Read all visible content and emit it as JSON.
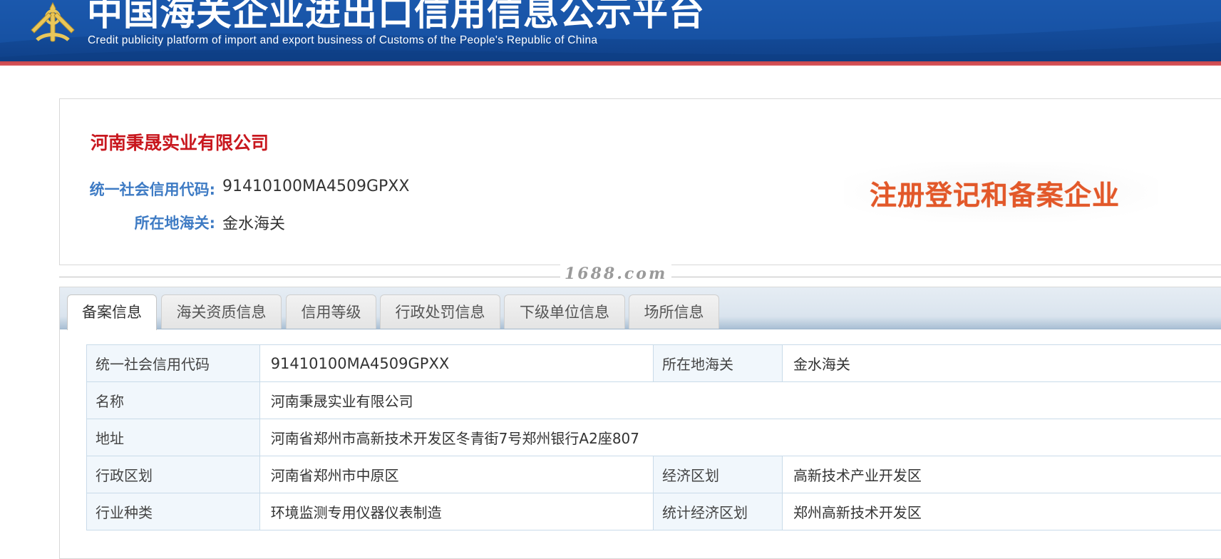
{
  "header": {
    "title_cn": "中国海关企业进出口信用信息公示平台",
    "title_en": "Credit publicity platform of import and export business of Customs of the People's Republic of China",
    "logo_icon": "customs-emblem-icon"
  },
  "company": {
    "name": "河南秉晟实业有限公司",
    "credit_code_label": "统一社会信用代码:",
    "credit_code": "91410100MA4509GPXX",
    "customs_label": "所在地海关:",
    "customs": "金水海关",
    "stamp": "注册登记和备案企业"
  },
  "watermark": "1688.com",
  "tabs": [
    {
      "label": "备案信息",
      "active": true
    },
    {
      "label": "海关资质信息",
      "active": false
    },
    {
      "label": "信用等级",
      "active": false
    },
    {
      "label": "行政处罚信息",
      "active": false
    },
    {
      "label": "下级单位信息",
      "active": false
    },
    {
      "label": "场所信息",
      "active": false
    }
  ],
  "record": {
    "credit_code_label": "统一社会信用代码",
    "credit_code": "91410100MA4509GPXX",
    "customs_label": "所在地海关",
    "customs": "金水海关",
    "name_label": "名称",
    "name": "河南秉晟实业有限公司",
    "address_label": "地址",
    "address": "河南省郑州市高新技术开发区冬青街7号郑州银行A2座807",
    "admin_region_label": "行政区划",
    "admin_region": "河南省郑州市中原区",
    "econ_region_label": "经济区划",
    "econ_region": "高新技术产业开发区",
    "industry_label": "行业种类",
    "industry": "环境监测专用仪器仪表制造",
    "stat_region_label": "统计经济区划",
    "stat_region": "郑州高新技术开发区"
  },
  "colors": {
    "header_blue": "#134a98",
    "header_red_stripe": "#d9555b",
    "company_name_red": "#c8171e",
    "label_blue": "#3e7bc4",
    "stamp_orange": "#e2582a",
    "table_border": "#c9dbe9"
  }
}
